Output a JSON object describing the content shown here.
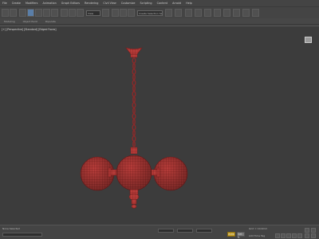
{
  "menu": [
    "File",
    "Create",
    "Modifiers",
    "Animation",
    "Graph Editors",
    "Rendering",
    "Civil View",
    "Customize",
    "Scripting",
    "Content",
    "Arnold",
    "Help"
  ],
  "toolbar": {
    "view_dropdown": "View",
    "selection_set_dropdown": "Create Selection Set"
  },
  "ribbon_tabs": [
    "Modeling",
    "Object Paint",
    "Populate"
  ],
  "viewport": {
    "label": "[+] [Perspective] [Standard] [Edged Faces]"
  },
  "status": {
    "object_info": "None Selected",
    "grid": "Grid = 10.0mm",
    "add_time_tag": "Add Time Tag",
    "auto_key": "Auto",
    "set_key": "Set K."
  },
  "colors": {
    "mesh": "#b83d3a",
    "mesh_wire": "#6e1818",
    "viewport_bg": "#3c3c3c"
  }
}
